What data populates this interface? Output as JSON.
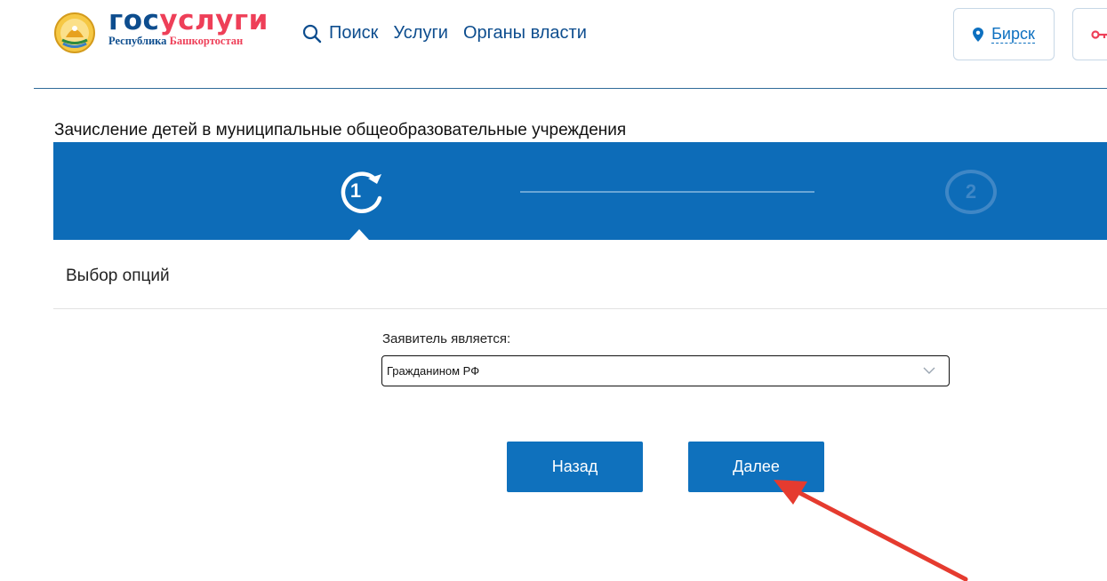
{
  "header": {
    "logo": {
      "main_part1": "гос",
      "main_part2": "услуги",
      "sub_part1": "Республика",
      "sub_part2": "Башкортостан"
    },
    "nav": {
      "search": "Поиск",
      "services": "Услуги",
      "authorities": "Органы власти"
    },
    "city": "Бирск"
  },
  "form": {
    "service_title": "Зачисление детей в муниципальные общеобразовательные учреждения",
    "steps": {
      "step1": "1",
      "step2": "2"
    },
    "section_title": "Выбор опций",
    "applicant_label": "Заявитель является:",
    "applicant_value": "Гражданином РФ",
    "back_label": "Назад",
    "next_label": "Далее"
  },
  "colors": {
    "brand_blue": "#0d4d8e",
    "brand_red": "#ee3f58",
    "stepper_blue": "#0d6cb8",
    "button_blue": "#0f71bd",
    "annotation_arrow": "#e53b2f"
  }
}
